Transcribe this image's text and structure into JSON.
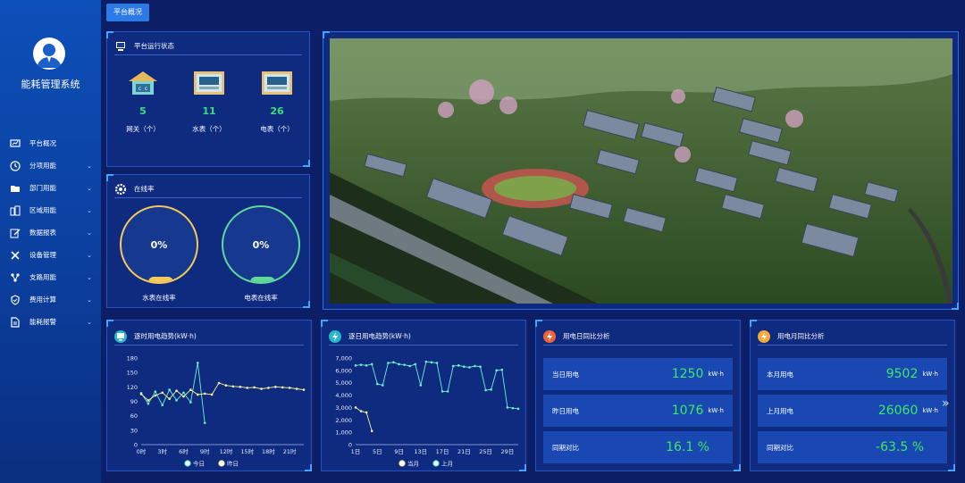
{
  "app": {
    "title": "能耗管理系统"
  },
  "sidebar": {
    "items": [
      {
        "label": "平台概况",
        "icon": "monitor-icon",
        "expandable": false
      },
      {
        "label": "分项用能",
        "icon": "clock-icon",
        "expandable": true
      },
      {
        "label": "部门用能",
        "icon": "folder-icon",
        "expandable": true
      },
      {
        "label": "区域用能",
        "icon": "building-icon",
        "expandable": true
      },
      {
        "label": "数据报表",
        "icon": "edit-icon",
        "expandable": true
      },
      {
        "label": "设备管理",
        "icon": "tools-icon",
        "expandable": true
      },
      {
        "label": "支路用能",
        "icon": "network-icon",
        "expandable": true
      },
      {
        "label": "费用计算",
        "icon": "shield-icon",
        "expandable": true
      },
      {
        "label": "能耗报警",
        "icon": "document-icon",
        "expandable": true
      }
    ]
  },
  "tab": {
    "active": "平台概况"
  },
  "status_panel": {
    "title": "平台运行状态",
    "items": [
      {
        "value": "5",
        "label": "网关（个）"
      },
      {
        "value": "11",
        "label": "水表（个）"
      },
      {
        "value": "26",
        "label": "电表（个）"
      }
    ]
  },
  "online_panel": {
    "title": "在线率",
    "water": {
      "value": "0%",
      "label": "水表在线率",
      "color": "#f5c95a"
    },
    "electric": {
      "value": "0%",
      "label": "电表在线率",
      "color": "#5fd89a"
    }
  },
  "hourly_chart": {
    "title": "逐时用电趋势(kW·h)",
    "legend_today": "今日",
    "legend_yesterday": "昨日"
  },
  "daily_chart": {
    "title": "逐日用电趋势(kW·h)",
    "legend_current": "当月",
    "legend_previous": "上月"
  },
  "day_compare": {
    "title": "用电日同比分析",
    "rows": [
      {
        "key": "当日用电",
        "value": "1250",
        "unit": "kW·h"
      },
      {
        "key": "昨日用电",
        "value": "1076",
        "unit": "kW·h"
      },
      {
        "key": "同期对比",
        "value": "16.1 %",
        "unit": ""
      }
    ]
  },
  "month_compare": {
    "title": "用电月同比分析",
    "rows": [
      {
        "key": "本月用电",
        "value": "9502",
        "unit": "kW·h"
      },
      {
        "key": "上月用电",
        "value": "26060",
        "unit": "kW·h"
      },
      {
        "key": "同期对比",
        "value": "-63.5 %",
        "unit": ""
      }
    ]
  },
  "chart_data": [
    {
      "type": "line",
      "title": "逐时用电趋势(kW·h)",
      "ylabel": "",
      "ylim": [
        0,
        180
      ],
      "yticks": [
        0,
        30,
        60,
        90,
        120,
        150,
        180
      ],
      "xticks": [
        "0时",
        "3时",
        "6时",
        "9时",
        "12时",
        "15时",
        "18时",
        "21时"
      ],
      "x": [
        0,
        1,
        2,
        3,
        4,
        5,
        6,
        7,
        8,
        9,
        10,
        11,
        12,
        13,
        14,
        15,
        16,
        17,
        18,
        19,
        20,
        21,
        22,
        23
      ],
      "series": [
        {
          "name": "今日",
          "color": "#6df0d0",
          "values": [
            107,
            85,
            110,
            82,
            114,
            92,
            108,
            88,
            170,
            45,
            null,
            null,
            null,
            null,
            null,
            null,
            null,
            null,
            null,
            null,
            null,
            null,
            null,
            null
          ]
        },
        {
          "name": "昨日",
          "color": "#f7f29a",
          "values": [
            105,
            92,
            102,
            108,
            95,
            112,
            100,
            114,
            104,
            106,
            104,
            128,
            123,
            121,
            120,
            118,
            119,
            116,
            118,
            120,
            119,
            118,
            116,
            114
          ]
        }
      ],
      "grid": false,
      "legend": "bottom"
    },
    {
      "type": "line",
      "title": "逐日用电趋势(kW·h)",
      "ylabel": "",
      "ylim": [
        0,
        7000
      ],
      "yticks": [
        "0",
        "1,000",
        "2,000",
        "3,000",
        "4,000",
        "5,000",
        "6,000",
        "7,000"
      ],
      "xticks": [
        "1日",
        "5日",
        "9日",
        "13日",
        "17日",
        "21日",
        "25日",
        "29日"
      ],
      "x": [
        1,
        2,
        3,
        4,
        5,
        6,
        7,
        8,
        9,
        10,
        11,
        12,
        13,
        14,
        15,
        16,
        17,
        18,
        19,
        20,
        21,
        22,
        23,
        24,
        25,
        26,
        27,
        28,
        29,
        30,
        31
      ],
      "series": [
        {
          "name": "当月",
          "color": "#f7f29a",
          "values": [
            3000,
            2700,
            2600,
            1100,
            null,
            null,
            null,
            null,
            null,
            null,
            null,
            null,
            null,
            null,
            null,
            null,
            null,
            null,
            null,
            null,
            null,
            null,
            null,
            null,
            null,
            null,
            null,
            null,
            null,
            null,
            null
          ]
        },
        {
          "name": "上月",
          "color": "#6df0d0",
          "values": [
            6400,
            6450,
            6400,
            6500,
            4900,
            4800,
            6600,
            6650,
            6500,
            6450,
            6350,
            6500,
            4800,
            6700,
            6650,
            6600,
            4300,
            4300,
            6350,
            6400,
            6300,
            6250,
            6350,
            6300,
            4400,
            4450,
            6000,
            6050,
            3000,
            2950,
            2900
          ]
        }
      ],
      "grid": false,
      "legend": "bottom"
    }
  ]
}
